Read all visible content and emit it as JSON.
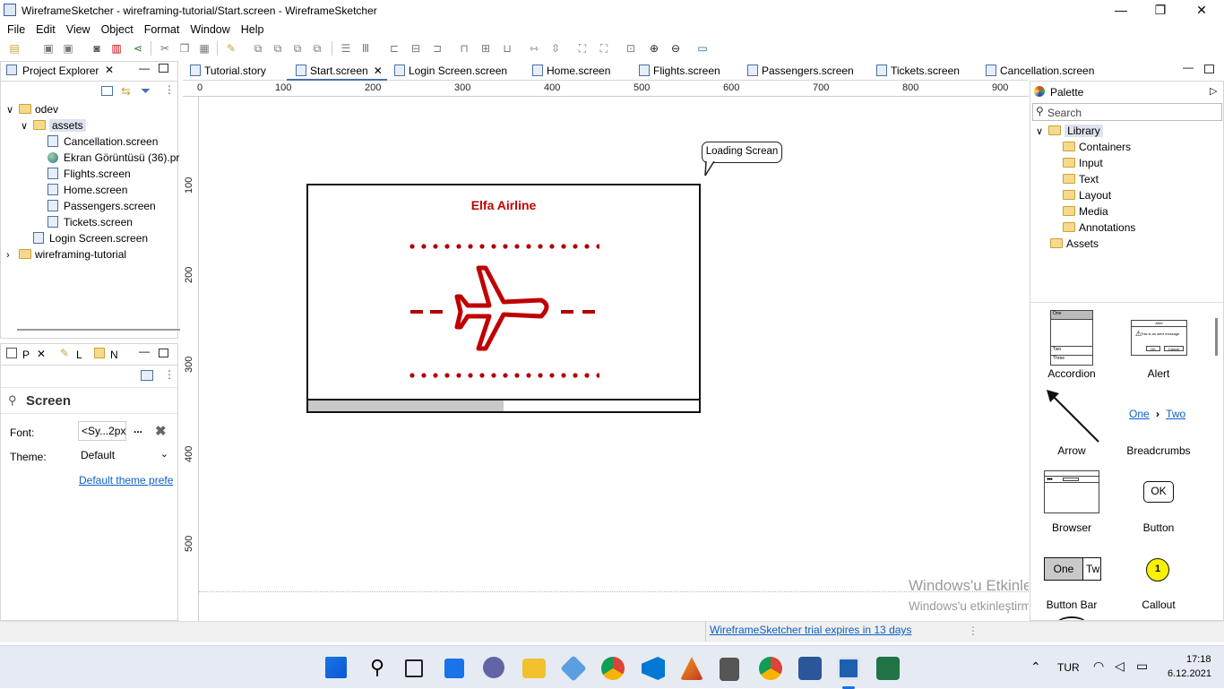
{
  "window": {
    "title": "WireframeSketcher - wireframing-tutorial/Start.screen - WireframeSketcher",
    "min": "—",
    "max": "❐",
    "close": "✕"
  },
  "menu": [
    "File",
    "Edit",
    "View",
    "Object",
    "Format",
    "Window",
    "Help"
  ],
  "project_explorer": {
    "tab": "Project Explorer",
    "close": "✕",
    "items": [
      {
        "label": "odev",
        "depth": 0,
        "type": "folder",
        "arrow": "∨"
      },
      {
        "label": "assets",
        "depth": 1,
        "type": "folder",
        "arrow": "∨",
        "selected": true
      },
      {
        "label": "Cancellation.screen",
        "depth": 2,
        "type": "screen"
      },
      {
        "label": "Ekran Görüntüsü (36).pr",
        "depth": 2,
        "type": "image"
      },
      {
        "label": "Flights.screen",
        "depth": 2,
        "type": "screen"
      },
      {
        "label": "Home.screen",
        "depth": 2,
        "type": "screen"
      },
      {
        "label": "Passengers.screen",
        "depth": 2,
        "type": "screen"
      },
      {
        "label": "Tickets.screen",
        "depth": 2,
        "type": "screen"
      },
      {
        "label": "Login Screen.screen",
        "depth": 1,
        "type": "screen"
      },
      {
        "label": "wireframing-tutorial",
        "depth": 0,
        "type": "folder",
        "arrow": ">"
      }
    ]
  },
  "props": {
    "tabs": [
      "P",
      "L",
      "N"
    ],
    "heading": "Screen",
    "font_label": "Font:",
    "font_value": "<Sy...2px",
    "font_more": "...",
    "theme_label": "Theme:",
    "theme_value": "Default",
    "link": "Default theme prefe"
  },
  "editor_tabs": [
    "Tutorial.story",
    "Start.screen",
    "Login Screen.screen",
    "Home.screen",
    "Flights.screen",
    "Passengers.screen",
    "Tickets.screen",
    "Cancellation.screen"
  ],
  "active_tab": "Start.screen",
  "ruler": {
    "h": [
      "0",
      "100",
      "200",
      "300",
      "400",
      "500",
      "600",
      "700",
      "800",
      "900"
    ],
    "v": [
      "100",
      "200",
      "300",
      "400",
      "500"
    ]
  },
  "canvas": {
    "callout": "Loading Screan",
    "app_title": "Elfa Airline",
    "accent": "#c00000"
  },
  "palette": {
    "title": "Palette",
    "search": "Search",
    "library": "Library",
    "folders": [
      "Containers",
      "Input",
      "Text",
      "Layout",
      "Media",
      "Annotations"
    ],
    "assets": "Assets",
    "widgets": [
      "Accordion",
      "Alert",
      "Arrow",
      "Breadcrumbs",
      "Browser",
      "Button",
      "Button Bar",
      "Callout"
    ],
    "accordion_rows": [
      "One",
      "Two",
      "Three"
    ],
    "alert": {
      "title": "Alert",
      "message": "This is an alert message",
      "ok": "OK",
      "cancel": "Cancel"
    },
    "breadcrumb": {
      "one": "One",
      "two": "Two",
      "sep": "›"
    },
    "button_ok": "OK",
    "buttonbar": {
      "one": "One",
      "two": "Tw"
    },
    "callout_num": "1"
  },
  "status": {
    "trial": "WireframeSketcher trial expires in 13 days"
  },
  "watermark": {
    "line1": "Windows'u Etkinleştir",
    "line2": "Windows'u etkinleştirmek için Ayarlar'a gidin"
  },
  "tray": {
    "lang": "TUR",
    "time": "17:18",
    "date": "6.12.2021"
  }
}
